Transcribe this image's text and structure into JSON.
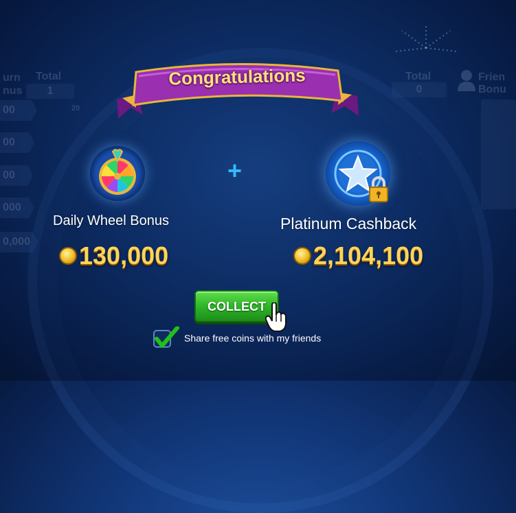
{
  "popup": {
    "title": "Congratulations",
    "left_reward": {
      "label": "Daily Wheel Bonus",
      "amount": "130,000",
      "icon": "prize-wheel-icon"
    },
    "plus_sign": "+",
    "right_reward": {
      "label": "Platinum Cashback",
      "amount": "2,104,100",
      "icon": "star-badge-lock-icon"
    },
    "collect_label": "COLLECT",
    "share": {
      "label": "Share free coins with my friends",
      "checked": true
    }
  },
  "background": {
    "left_panel": {
      "title_partial": "urn",
      "subtitle_partial": "nus",
      "total_label": "Total",
      "total_value": "1",
      "small_value": "20",
      "rows": [
        "00",
        "00",
        "00",
        "000",
        "0,000"
      ]
    },
    "right_panel": {
      "total_label": "Total",
      "total_value": "0",
      "friends_partial": "Frien",
      "bonus_partial": "Bonu"
    }
  },
  "colors": {
    "accent_gold": "#ffd45a",
    "ribbon_purple": "#9a2fb0",
    "collect_green": "#2fb52a",
    "plus_blue": "#36b8ff"
  }
}
